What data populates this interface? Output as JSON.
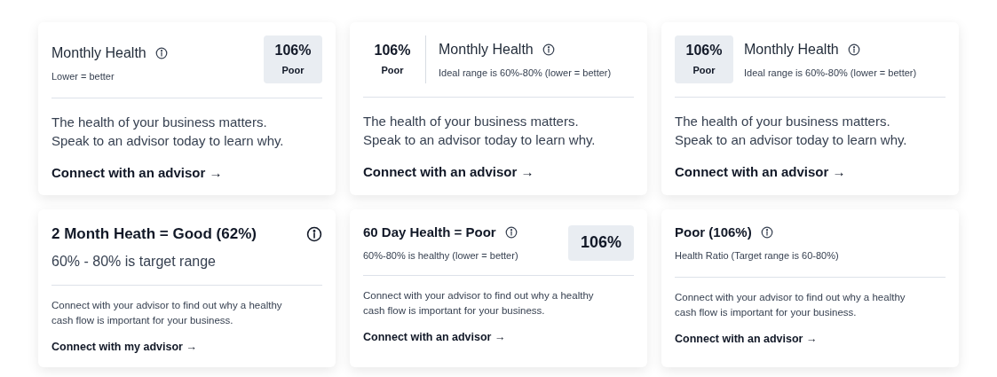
{
  "cards": [
    {
      "kind": "badge-right",
      "title": "Monthly Health",
      "subtitle": "Lower = better",
      "score": {
        "value": "106%",
        "rating": "Poor"
      },
      "body": "The health of your business matters. Speak to an advisor today to learn why.",
      "link": "Connect with an advisor →"
    },
    {
      "kind": "score-divider",
      "title": "Monthly Health",
      "subtitle": "Ideal range is 60%-80% (lower = better)",
      "score": {
        "value": "106%",
        "rating": "Poor"
      },
      "body": "The health of your business matters. Speak to an advisor today to learn why.",
      "link": "Connect with an advisor →"
    },
    {
      "kind": "badge-left",
      "title": "Monthly Health",
      "subtitle": "Ideal range is 60%-80% (lower = better)",
      "score": {
        "value": "106%",
        "rating": "Poor"
      },
      "body": "The health of your business matters. Speak to an advisor today to learn why.",
      "link": "Connect with an advisor →"
    },
    {
      "kind": "title-icon-right",
      "title": "2 Month Heath = Good (62%)",
      "subtitle": "60% - 80% is target range",
      "body": "Connect with your advisor to find out why a healthy cash flow is important for your business.",
      "link": "Connect with my advisor →"
    },
    {
      "kind": "value-right",
      "title": "60 Day Health = Poor",
      "subtitle": "60%-80% is healthy (lower = better)",
      "score": {
        "value": "106%"
      },
      "body": "Connect with your advisor to find out why a healthy cash flow is important for your business.",
      "link": "Connect with an advisor →"
    },
    {
      "kind": "title-bold",
      "title": "Poor (106%)",
      "subtitle": "Health Ratio (Target range is 60-80%)",
      "body": "Connect with your advisor to find out why a healthy cash flow is important for your business.",
      "link": "Connect with an advisor →"
    }
  ]
}
